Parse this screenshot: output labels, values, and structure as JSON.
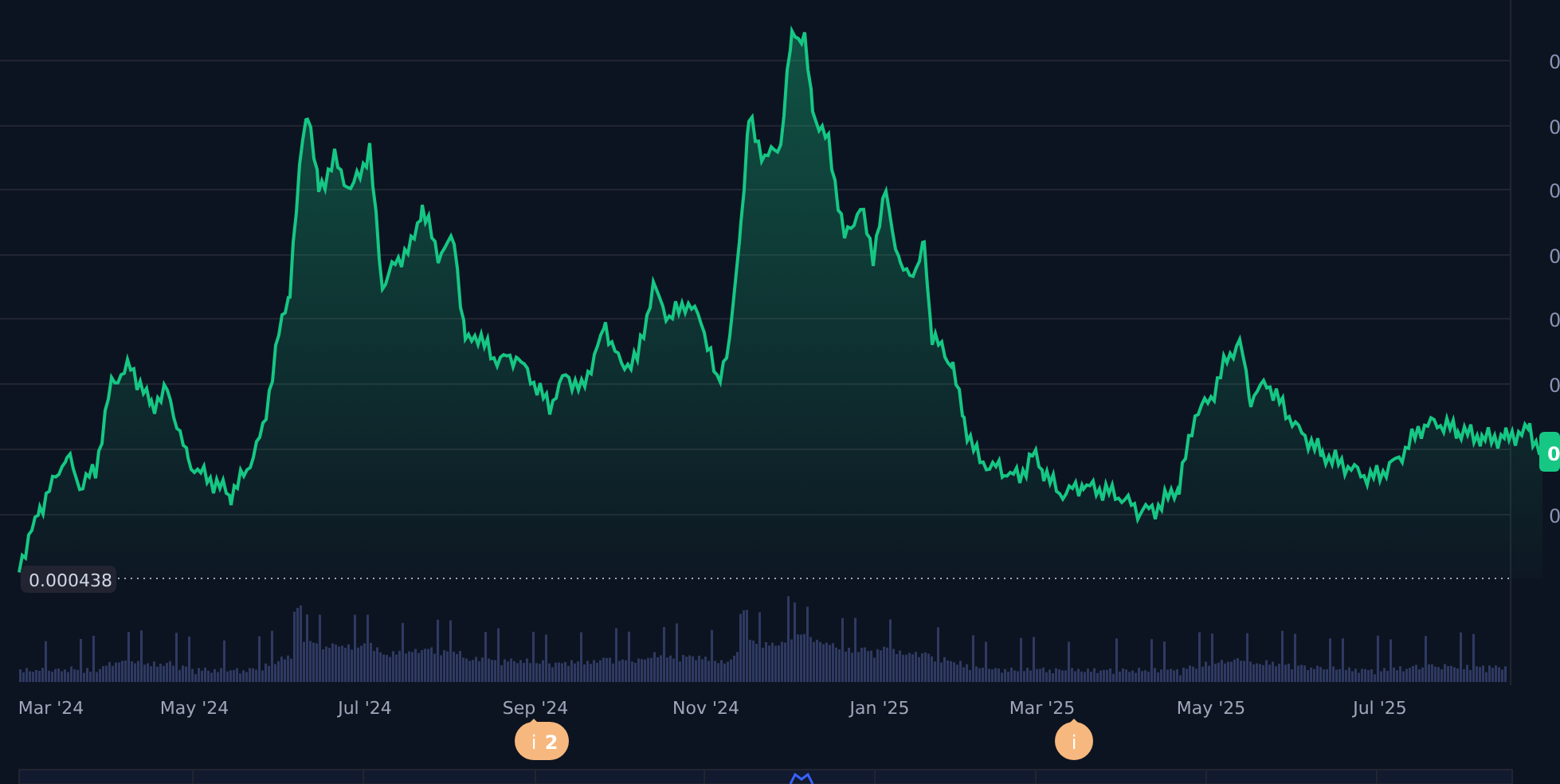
{
  "chart": {
    "y_axis_labels": [
      "0",
      "0",
      "0",
      "0",
      "0",
      "0",
      "0"
    ],
    "current_price_tag": "0",
    "baseline_label": "0.000438",
    "x_axis_labels": [
      "Mar '24",
      "May '24",
      "Jul '24",
      "Sep '24",
      "Nov '24",
      "Jan '25",
      "Mar '25",
      "May '25",
      "Jul '25"
    ]
  },
  "events": [
    {
      "icon": "i",
      "count": "2"
    },
    {
      "icon": "i"
    }
  ]
}
